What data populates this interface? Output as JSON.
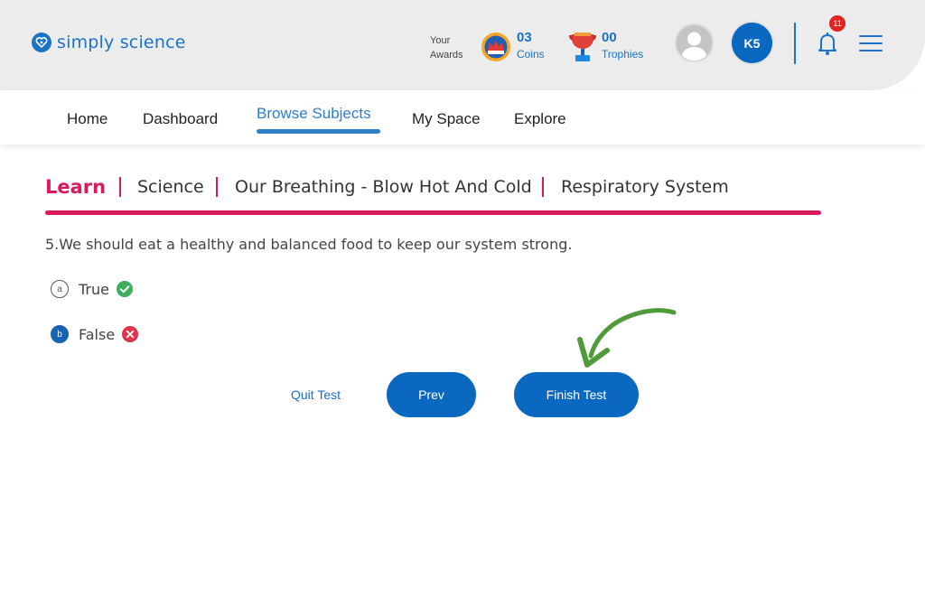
{
  "brand": {
    "name": "simply science",
    "color": "#1a73c7",
    "icon": "heart-logo-icon"
  },
  "awards": {
    "label": "Your Awards",
    "coins": {
      "count": "03",
      "label": "Coins",
      "icon": "coin-crown-icon"
    },
    "trophies": {
      "count": "00",
      "label": "Trophies",
      "icon": "trophy-icon"
    }
  },
  "user": {
    "avatar_icon": "user-avatar-icon",
    "grade": "K5"
  },
  "notifications": {
    "count": "11",
    "icon": "bell-icon"
  },
  "menu": {
    "icon": "hamburger-menu-icon"
  },
  "nav": {
    "items": [
      {
        "label": "Home"
      },
      {
        "label": "Dashboard"
      },
      {
        "label": "Browse Subjects",
        "active": true
      },
      {
        "label": "My Space"
      },
      {
        "label": "Explore"
      }
    ]
  },
  "breadcrumb": {
    "section": "Learn",
    "items": [
      "Science",
      "Our Breathing - Blow Hot And Cold",
      "Respiratory System"
    ],
    "accent_color": "#d81b5a"
  },
  "question": {
    "text": "5.We should eat a healthy and balanced food to keep our system strong.",
    "options": [
      {
        "letter": "a",
        "label": "True",
        "selected": false,
        "result": "correct",
        "result_icon": "check-circle-icon"
      },
      {
        "letter": "b",
        "label": "False",
        "selected": true,
        "result": "incorrect",
        "result_icon": "x-circle-icon"
      }
    ]
  },
  "actions": {
    "quit_label": "Quit Test",
    "prev_label": "Prev",
    "finish_label": "Finish Test",
    "button_color": "#0b68c1",
    "pointer_icon": "green-arrow-icon"
  }
}
